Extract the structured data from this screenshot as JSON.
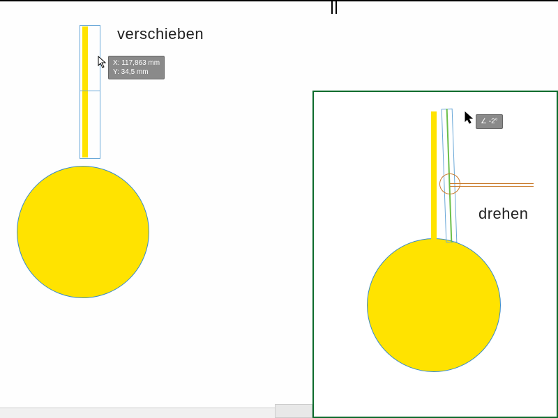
{
  "left": {
    "label": "verschieben",
    "tooltip": {
      "x_label": "X: 117,863 mm",
      "y_label": "Y: 34,5 mm"
    }
  },
  "right": {
    "label": "drehen",
    "tooltip": {
      "angle": "∠ -2°"
    }
  }
}
